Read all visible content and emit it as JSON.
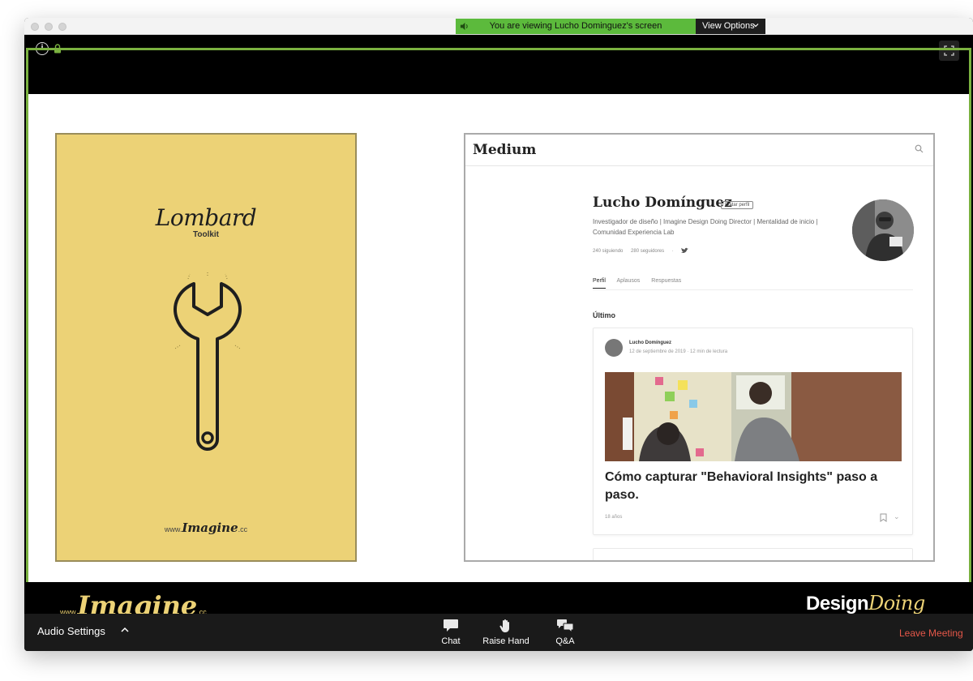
{
  "share_banner": {
    "text": "You are viewing Lucho Dominguez's screen",
    "view_options": "View Options"
  },
  "slide": {
    "poster": {
      "title": "Lombard",
      "subtitle": "Toolkit",
      "url_prefix": "www.",
      "url_brand": "Imagine",
      "url_suffix": ".cc"
    },
    "medium": {
      "logo": "Medium",
      "profile_name": "Lucho Domínguez",
      "edit_profile": "Editar perfil",
      "bio": "Investigador de diseño | Imagine Design Doing Director | Mentalidad de inicio | Comunidad Experiencia Lab",
      "following": "240 siguiendo",
      "followers": "280 seguidores",
      "tabs": [
        "Perfil",
        "Aplausos",
        "Respuestas"
      ],
      "section_title": "Último",
      "post": {
        "author": "Lucho Domínguez",
        "meta": "12 de septiembre de 2019 · 12 min de lectura",
        "title": "Cómo capturar \"Behavioral Insights\" paso a paso.",
        "claps": "18 años"
      }
    },
    "footer": {
      "imagine_prefix": "www.",
      "imagine_brand": "Imagine",
      "imagine_suffix": ".cc",
      "design": "Design",
      "doing": "Doing"
    }
  },
  "toolbar": {
    "audio_settings": "Audio Settings",
    "chat": "Chat",
    "raise_hand": "Raise Hand",
    "qa": "Q&A",
    "leave_meeting": "Leave Meeting"
  },
  "colors": {
    "share_green": "#5cba3c",
    "poster_yellow": "#ecd276",
    "leave_red": "#e55749",
    "toolbar_bg": "#1a1a1a"
  }
}
